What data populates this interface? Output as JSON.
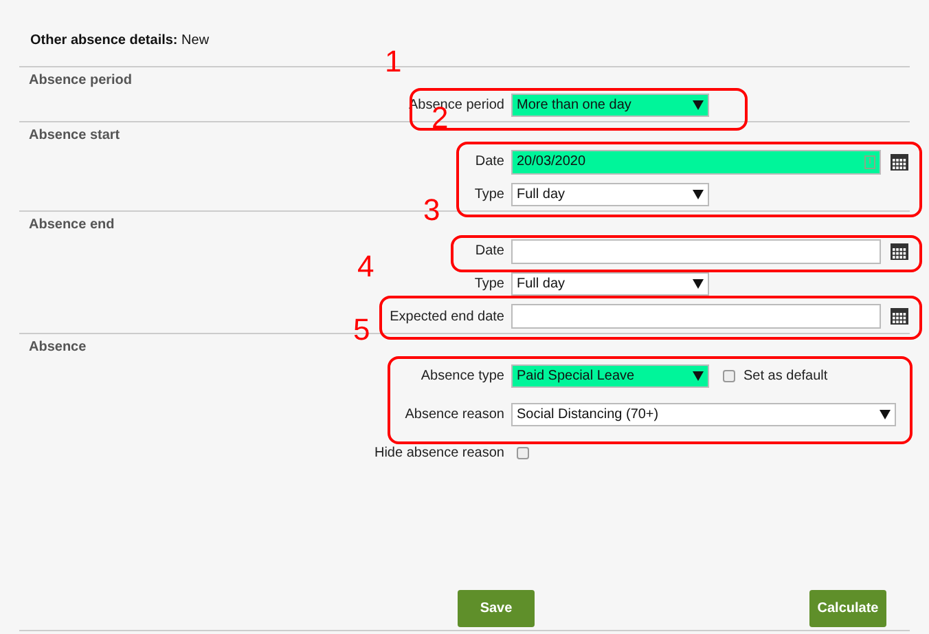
{
  "header": {
    "label": "Other absence details:",
    "value": "New"
  },
  "sections": [
    {
      "title": "Absence period",
      "fields": [
        {
          "kind": "select",
          "label": "Absence period",
          "value": "More than one day",
          "highlighted": true
        }
      ]
    },
    {
      "title": "Absence start",
      "fields": [
        {
          "kind": "date",
          "label": "Date",
          "value": "20/03/2020",
          "highlighted": true,
          "indicator": true
        },
        {
          "kind": "select",
          "label": "Type",
          "value": "Full day",
          "highlighted": false
        }
      ]
    },
    {
      "title": "Absence end",
      "fields": [
        {
          "kind": "date",
          "label": "Date",
          "highlighted": false
        },
        {
          "kind": "select",
          "label": "Type",
          "value": "Full day",
          "highlighted": false
        },
        {
          "kind": "date",
          "label": "Expected end date",
          "highlighted": false
        }
      ]
    },
    {
      "title": "Absence",
      "fields": [
        {
          "kind": "select",
          "label": "Absence type",
          "value": "Paid Special Leave",
          "highlighted": true,
          "option": {
            "label": "Set as default",
            "checked": false
          }
        },
        {
          "kind": "long_select",
          "label": "Absence reason",
          "value": "Social Distancing (70+)",
          "highlighted": false
        },
        {
          "kind": "checkbox",
          "label": "Hide absence reason",
          "checked": false
        }
      ]
    }
  ],
  "buttons": [
    {
      "label": "Save"
    },
    {
      "label": "Calculate"
    }
  ],
  "callouts": [
    {
      "number": "1"
    },
    {
      "number": "2"
    },
    {
      "number": "3"
    },
    {
      "number": "4"
    },
    {
      "number": "5"
    }
  ]
}
